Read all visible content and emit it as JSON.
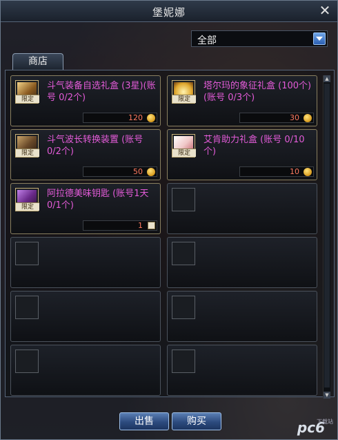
{
  "window": {
    "title": "堡妮娜",
    "close_icon": "close-icon"
  },
  "filter": {
    "selected": "全部"
  },
  "tab": {
    "label": "商店"
  },
  "items": [
    {
      "name": "斗气装备自选礼盒 (3星)(账号 0/2个)",
      "price": "120",
      "currency": "coin-icon",
      "tag": "限定"
    },
    {
      "name": "塔尔玛的象征礼盒 (100个)(账号 0/3个)",
      "price": "30",
      "currency": "coin-icon",
      "tag": "限定"
    },
    {
      "name": "斗气波长转换装置 (账号 0/2个)",
      "price": "50",
      "currency": "coin-icon",
      "tag": "限定"
    },
    {
      "name": "艾肯助力礼盒 (账号 0/10个)",
      "price": "10",
      "currency": "coin-icon",
      "tag": "限定"
    },
    {
      "name": "阿拉德美味钥匙 (账号1天 0/1个)",
      "price": "1",
      "currency": "key-icon",
      "tag": "限定"
    }
  ],
  "buttons": {
    "sell": "出售",
    "buy": "购买"
  },
  "watermark": {
    "logo": "pc6",
    "sub": "下载站"
  }
}
